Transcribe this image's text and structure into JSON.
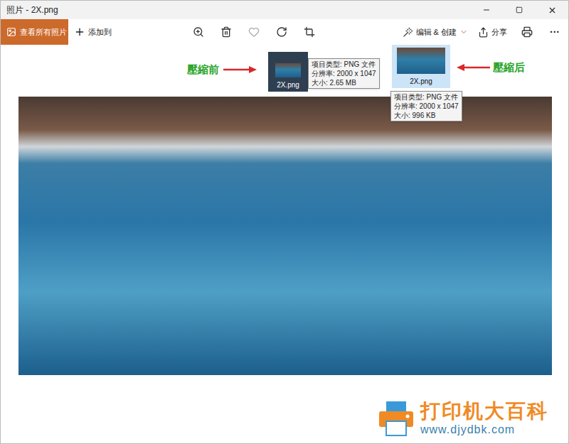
{
  "window": {
    "title": "照片 - 2X.png"
  },
  "toolbar": {
    "view_all": "查看所有照片",
    "add_to": "添加到",
    "favorite": false,
    "edit_create": "编辑 & 创建",
    "share": "分享",
    "more": "···"
  },
  "annotations": [
    {
      "label": "壓縮前",
      "file": "2X.png",
      "selected": false,
      "tooltip": [
        "项目类型: PNG 文件",
        "分辨率: 2000 x 1047",
        "大小: 2.65 MB"
      ]
    },
    {
      "label": "壓縮后",
      "file": "2X.png",
      "selected": true,
      "tooltip": [
        "项目类型: PNG 文件",
        "分辨率: 2000 x 1047",
        "大小: 996 KB"
      ]
    }
  ],
  "watermark": {
    "name": "打印机大百科",
    "url": "www.djydbk.com"
  }
}
